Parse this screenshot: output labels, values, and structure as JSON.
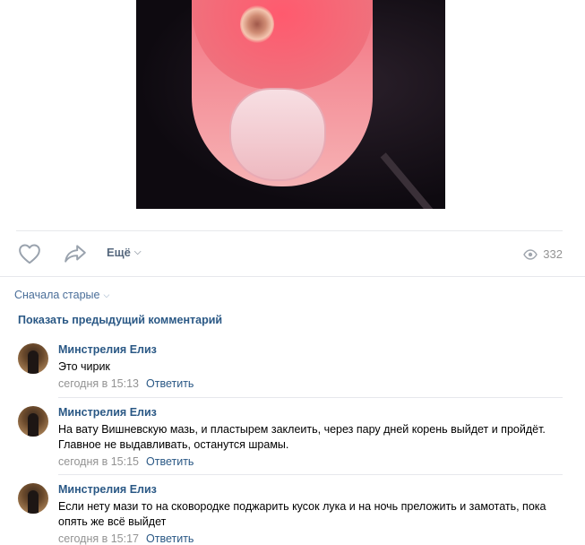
{
  "post": {
    "more_label": "Ещё",
    "views_count": "332"
  },
  "comments_section": {
    "sort_label": "Сначала старые",
    "show_previous_label": "Показать предыдущий комментарий",
    "items": [
      {
        "author": "Минстрелия Елиз",
        "text": "Это чирик",
        "time": "сегодня в 15:13",
        "reply_label": "Ответить"
      },
      {
        "author": "Минстрелия Елиз",
        "text": "На вату Вишневскую мазь, и пластырем заклеить, через пару дней корень выйдет и пройдёт. Главное не выдавливать, останутся шрамы.",
        "time": "сегодня в 15:15",
        "reply_label": "Ответить"
      },
      {
        "author": "Минстрелия Елиз",
        "text": "Если нету мази то на сковородке поджарить кусок лука и на ночь преложить и замотать, пока опять же всё выйдет",
        "time": "сегодня в 15:17",
        "reply_label": "Ответить"
      }
    ]
  },
  "colors": {
    "link": "#2a5885",
    "muted": "#939393",
    "divider": "#e7e8ec",
    "icon": "#99a2ad"
  },
  "icons": {
    "like": "heart-icon",
    "share": "share-arrow-icon",
    "views": "eye-icon",
    "chevron": "chevron-down-icon"
  }
}
